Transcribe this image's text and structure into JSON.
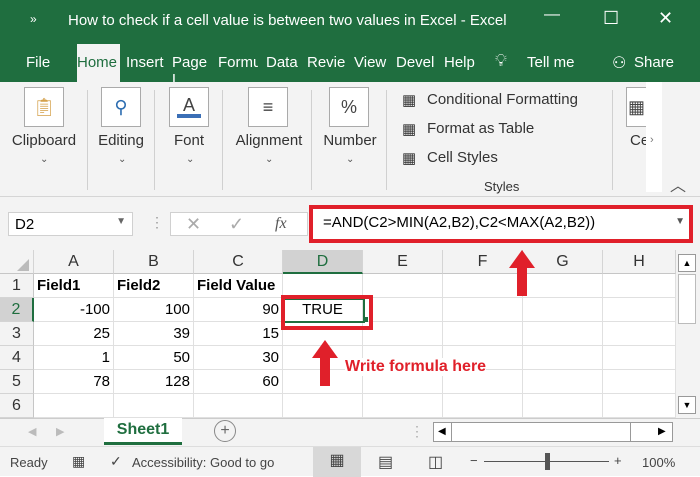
{
  "window": {
    "title": "How to check if a cell value is between two values in Excel  -  Excel",
    "minimize": "—",
    "restore": "☐",
    "close": "✕"
  },
  "tabs": [
    {
      "label": "File"
    },
    {
      "label": "Home"
    },
    {
      "label": "Insert"
    },
    {
      "label": "Page L"
    },
    {
      "label": "Formu"
    },
    {
      "label": "Data"
    },
    {
      "label": "Revie"
    },
    {
      "label": "View"
    },
    {
      "label": "Devel"
    },
    {
      "label": "Help"
    }
  ],
  "tell_me": "Tell me",
  "share": "Share",
  "ribbon": {
    "groups": [
      {
        "label": "Clipboard",
        "icon": "clipboard-icon"
      },
      {
        "label": "Editing",
        "icon": "search-icon"
      },
      {
        "label": "Font",
        "icon": "font-icon"
      },
      {
        "label": "Alignment",
        "icon": "align-icon"
      },
      {
        "label": "Number",
        "icon": "percent-icon"
      }
    ],
    "styles": {
      "conditional": "Conditional Formatting",
      "format_table": "Format as Table",
      "cell_styles": "Cell Styles",
      "group_label": "Styles"
    },
    "cells_label": "Ce"
  },
  "formula_bar": {
    "name_box": "D2",
    "formula": "=AND(C2>MIN(A2,B2),C2<MAX(A2,B2))",
    "fx": "fx"
  },
  "columns": [
    "A",
    "B",
    "C",
    "D",
    "E",
    "F",
    "G",
    "H"
  ],
  "rows": [
    "1",
    "2",
    "3",
    "4",
    "5",
    "6"
  ],
  "cells": [
    [
      "Field1",
      "Field2",
      "Field Value",
      ""
    ],
    [
      "-100",
      "100",
      "90",
      "TRUE"
    ],
    [
      "25",
      "39",
      "15",
      ""
    ],
    [
      "1",
      "50",
      "30",
      ""
    ],
    [
      "78",
      "128",
      "60",
      ""
    ],
    [
      "",
      "",
      "",
      ""
    ]
  ],
  "annotation": "Write formula here",
  "sheet_tab": "Sheet1",
  "status": {
    "ready": "Ready",
    "accessibility": "Accessibility: Good to go",
    "zoom": "100%",
    "zoom_level": 100
  },
  "colors": {
    "excel_green": "#1f6e3f",
    "annotation_red": "#e0202a"
  }
}
